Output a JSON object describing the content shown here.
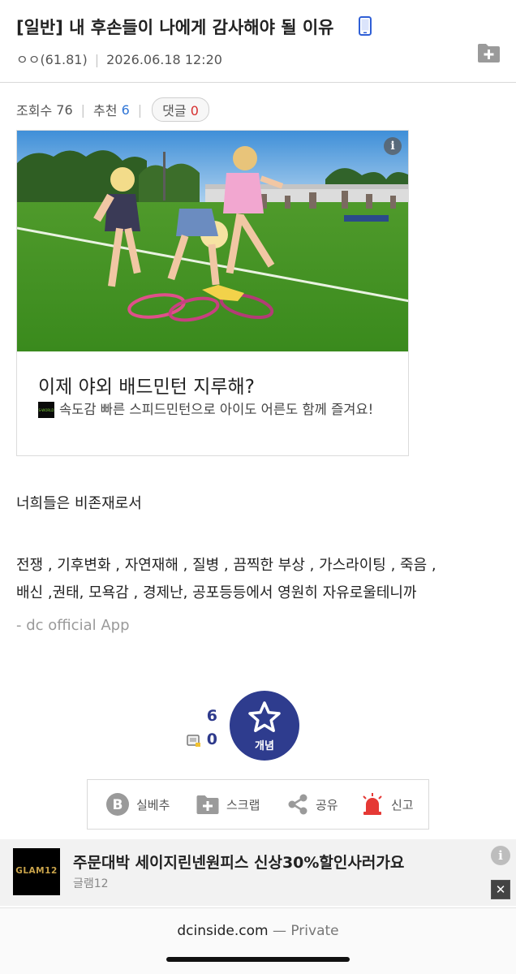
{
  "post": {
    "title": "[일반] 내 후손들이 나에게 감사해야 될 이유",
    "device_icon": "mobile-phone-icon",
    "author": "ㅇㅇ(61.81)",
    "date": "2026.06.18 12:20",
    "stats": {
      "views_label": "조회수",
      "views": "76",
      "recommend_label": "추천",
      "recommend": "6",
      "comments_label": "댓글",
      "comments": "0"
    }
  },
  "ad_card": {
    "headline": "이제 야외 배드민턴 지루해?",
    "description": "속도감 빠른 스피드민턴으로 아이도 어른도 함께 즐겨요!",
    "logo_text": "S-WORLD",
    "info_glyph": "i"
  },
  "content": {
    "line1": "너희들은 비존재로서",
    "line2": "전쟁 , 기후변화 , 자연재해 , 질병 , 끔찍한 부상 , 가스라이팅 , 죽음 ,",
    "line3": "배신 ,권태, 모욕감 , 경제난, 공포등등에서 영원히 자유로울테니까",
    "signature": "- dc official App"
  },
  "vote": {
    "up_count": "6",
    "down_count": "0",
    "button_label": "개념"
  },
  "actions": {
    "unrecommend": "실베추",
    "scrap": "스크랩",
    "share": "공유",
    "report": "신고"
  },
  "bottom_ad": {
    "logo_text": "GLAM12",
    "title": "주문대박 세이지린넨원피스 신상30%할인사러가요",
    "advertiser": "글램12",
    "info_glyph": "i",
    "close_glyph": "✕"
  },
  "browser": {
    "domain": "dcinside.com",
    "mode": "— Private"
  },
  "colors": {
    "accent_blue": "#2f75d6",
    "accent_red": "#d62f2f",
    "vote_navy": "#2e3c8e",
    "report_red": "#e53935"
  }
}
